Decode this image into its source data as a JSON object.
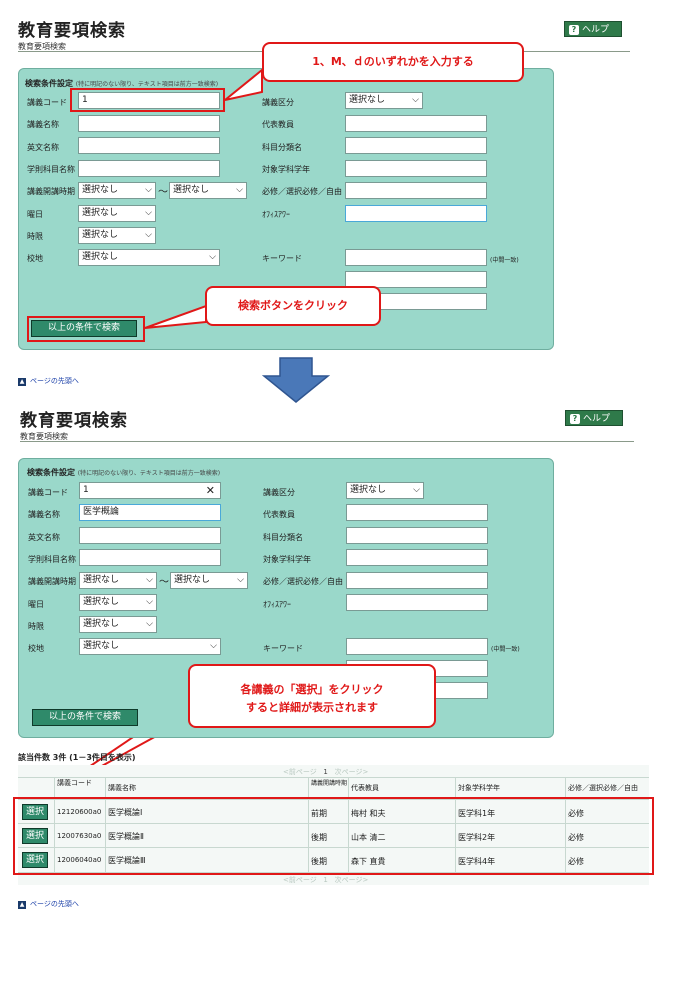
{
  "header": {
    "title": "教育要項検索",
    "subtitle": "教育要項検索",
    "help_label": "ヘルプ",
    "help_q": "?"
  },
  "form": {
    "heading": "検索条件設定",
    "note": "(特に明記のない限り、テキスト項目は前方一致検索)",
    "labels": {
      "course_code": "講義コード",
      "course_name": "講義名称",
      "english_name": "英文名称",
      "subject_name": "学則科目名称",
      "period": "講義開講時期",
      "weekday": "曜日",
      "time_slot": "時限",
      "campus": "校地",
      "category": "講義区分",
      "teacher": "代表教員",
      "subject_class": "科目分類名",
      "target": "対象学科学年",
      "required": "必修／選択必修／自由",
      "office_hour": "ｵﾌｨｽｱﾜｰ",
      "keyword": "キーワード",
      "keyword_note": "(中間一致)"
    },
    "tilde": "～",
    "select_none": "選択なし",
    "search_button": "以上の条件で検索"
  },
  "step1": {
    "course_code_value": "1",
    "course_name_value": "",
    "callout": "1、M、ｄのいずれかを入力する",
    "callout2": "検索ボタンをクリック"
  },
  "step2": {
    "course_code_value": "1",
    "clear_x": "✕",
    "course_name_value": "医学概論",
    "callout_line1": "各講義の「選択」をクリック",
    "callout_line2": "すると詳細が表示されます"
  },
  "pagetop": "ページの先頭へ",
  "results": {
    "count_text": "該当件数 3件 (1－3件目を表示)",
    "pager_prev": "<前ページ",
    "pager_page": "1",
    "pager_next": "次ページ>",
    "headers": {
      "code": "講義コード",
      "name": "講義名称",
      "period": "講義開講時期",
      "teacher": "代表教員",
      "target": "対象学科学年",
      "required": "必修／選択必修／自由"
    },
    "select_label": "選択",
    "rows": [
      {
        "code": "12120600a0",
        "name": "医学概論Ⅰ",
        "period": "前期",
        "teacher": "梅村 和夫",
        "target": "医学科1年",
        "required": "必修"
      },
      {
        "code": "12007630a0",
        "name": "医学概論Ⅱ",
        "period": "後期",
        "teacher": "山本 清二",
        "target": "医学科2年",
        "required": "必修"
      },
      {
        "code": "12006040a0",
        "name": "医学概論Ⅲ",
        "period": "後期",
        "teacher": "森下 直貴",
        "target": "医学科4年",
        "required": "必修"
      }
    ]
  },
  "colors": {
    "panel_bg": "#9ad8ca",
    "accent_red": "#e01818",
    "button_green": "#2f8a6a",
    "arrow_blue": "#4a78b8"
  },
  "icons": {
    "help": "question-icon",
    "arrow": "down-arrow-icon",
    "pagetop": "up-triangle-icon"
  }
}
